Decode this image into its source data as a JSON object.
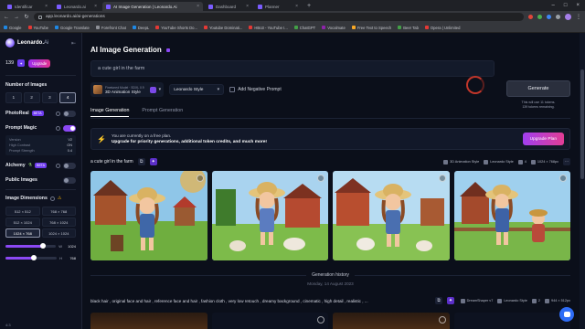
{
  "browser": {
    "tabs": [
      {
        "label": "Identificar",
        "active": false
      },
      {
        "label": "Leonardo.ai",
        "active": false
      },
      {
        "label": "AI Image Generation | Leonardo.Ai",
        "active": true
      },
      {
        "label": "Dashboard",
        "active": false
      },
      {
        "label": "Planner",
        "active": false
      }
    ],
    "url": "app.leonardo.ai/ai-generations",
    "bookmarks": [
      "Google",
      "YouTube",
      "Google Translate",
      "Forefront Chat",
      "DeepL",
      "YouTube Shorts Do...",
      "Youtube Dominati...",
      "HBo3 - YouTube I...",
      "ChatGPT",
      "Vocalmate",
      "Free Text to Speech",
      "Beer Tab",
      "Opera | Unlimited"
    ]
  },
  "sidebar": {
    "brand": "Leonardo.",
    "brand_suffix": "Ai",
    "token_count": "139",
    "upgrade_label": "Upgrade",
    "number_of_images_label": "Number of Images",
    "number_options": [
      "1",
      "2",
      "3",
      "4"
    ],
    "selected_number": "4",
    "photoreal_label": "PhotoReal",
    "photoreal_badge": "BETA",
    "prompt_magic_label": "Prompt Magic",
    "prompt_magic_rows": [
      {
        "label": "Version",
        "value": "V2"
      },
      {
        "label": "High Contrast",
        "value": "ON"
      },
      {
        "label": "Prompt Strength",
        "value": "0.4"
      }
    ],
    "alchemy_label": "Alchemy",
    "alchemy_badge": "BETA",
    "public_images_label": "Public Images",
    "image_dimensions_label": "Image Dimensions",
    "dimensions": [
      "512 × 512",
      "768 × 768",
      "512 × 1024",
      "768 × 1024",
      "1024 × 768",
      "1024 × 1024"
    ],
    "selected_dimension": "1024 × 768",
    "width_label": "W",
    "width_value": "1024",
    "height_label": "H",
    "height_value": "768",
    "width_fraction": 0.75,
    "height_fraction": 0.55,
    "aspect_label": "4:3"
  },
  "main": {
    "title": "AI Image Generation",
    "prompt_value": "a cute girl in the farm",
    "model_small": "Finetuned Model",
    "model_tag": "SDXL 0.9",
    "model_name": "3D Animation Style",
    "style_value": "Leonardo Style",
    "negative_prompt_label": "Add Negative Prompt",
    "generate_label": "Generate",
    "generate_note_1": "This will use 11 tokens.",
    "generate_note_2": "139 tokens remaining.",
    "tabs": [
      {
        "label": "Image Generation",
        "active": true
      },
      {
        "label": "Prompt Generation",
        "active": false
      }
    ],
    "banner": {
      "line1": "You are currently on a free plan.",
      "line2": "Upgrade for priority generations, additional token credits, and much more!",
      "button": "Upgrade Plan"
    },
    "generation": {
      "prompt": "a cute girl in the farm",
      "model_chip": "3D Animation Style",
      "style_chip": "Leonardo Style",
      "count_chip": "4",
      "size_chip": "1024 × 768px"
    },
    "history_label": "Generation history",
    "history_date": "Monday, 14 August 2023",
    "generation2": {
      "prompt": "black hair , original face and hair , reference face and hair , fashion cloth , very low retouch , dreamy background , cinematic , high detail , realistic , ...",
      "model_chip": "DreamShaper v7",
      "style_chip": "Leonardo Style",
      "count_chip": "2",
      "size_chip": "944 × 512px"
    }
  },
  "colors": {
    "accent": "#8b48f4",
    "upgrade_gradient_start": "#9c2ef0",
    "upgrade_gradient_end": "#e2338f",
    "background": "#0b0f1a"
  }
}
